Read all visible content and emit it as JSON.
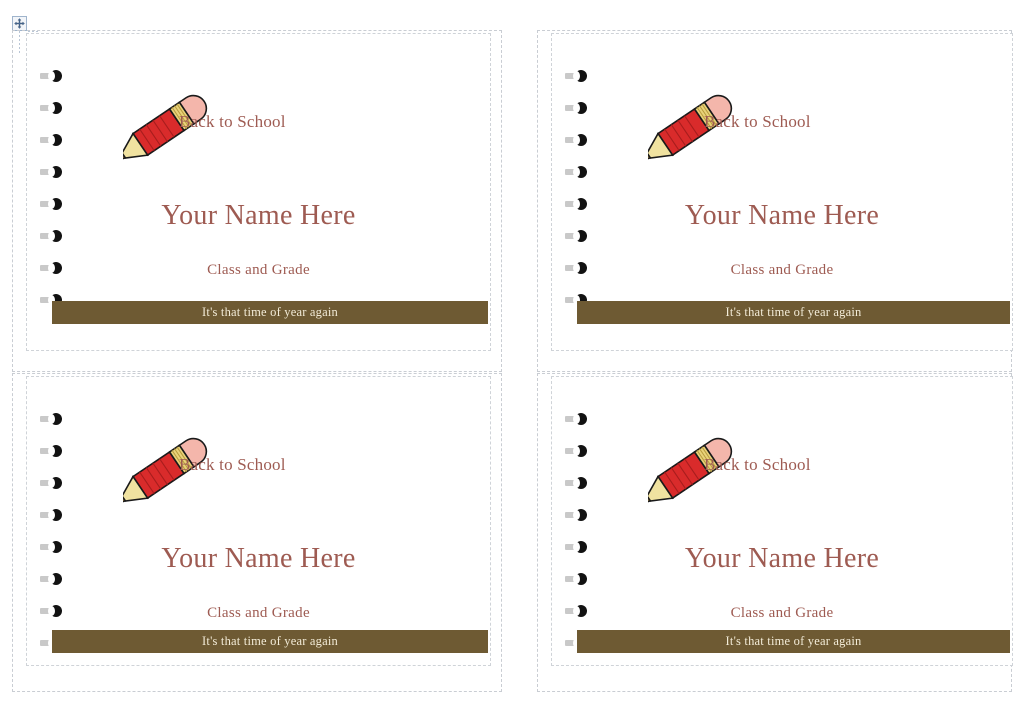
{
  "document": {
    "type": "word-document-page",
    "background_color": "#ffffff",
    "grid_color": "#c9cdd3",
    "handle": {
      "name": "table-move-handle",
      "icon": "move-four-arrow-icon",
      "border_color": "#9fb4cc",
      "fill_color": "#f2f5f9"
    }
  },
  "theme": {
    "text_color": "#9e5b52",
    "footer_bar_color": "#6e5a33",
    "footer_text_color": "#f3ecd8",
    "ring_bead_color": "#121212",
    "ring_tail_color": "#c9c9c9",
    "pencil_body_color": "#d92b2b",
    "pencil_eraser_color": "#f4b6ab",
    "pencil_ferrule_color": "#e8d27a",
    "pencil_tip_color": "#f0e2a0",
    "pencil_lead_color": "#7a6235",
    "card_border_color": "#cfd3d8"
  },
  "card_template": {
    "heading": "Back to School",
    "name_placeholder": "Your Name Here",
    "class_placeholder": "Class and Grade",
    "footer_text": "It's that time of year again",
    "pencil_icon": "pencil-icon",
    "spiral_ring_count": 8
  },
  "cards": [
    {
      "index": 1,
      "heading": "Back to School",
      "name_placeholder": "Your Name Here",
      "class_placeholder": "Class and Grade",
      "footer_text": "It's that time of year again"
    },
    {
      "index": 2,
      "heading": "Back to School",
      "name_placeholder": "Your Name Here",
      "class_placeholder": "Class and Grade",
      "footer_text": "It's that time of year again"
    },
    {
      "index": 3,
      "heading": "Back to School",
      "name_placeholder": "Your Name Here",
      "class_placeholder": "Class and Grade",
      "footer_text": "It's that time of year again"
    },
    {
      "index": 4,
      "heading": "Back to School",
      "name_placeholder": "Your Name Here",
      "class_placeholder": "Class and Grade",
      "footer_text": "It's that time of year again"
    }
  ]
}
